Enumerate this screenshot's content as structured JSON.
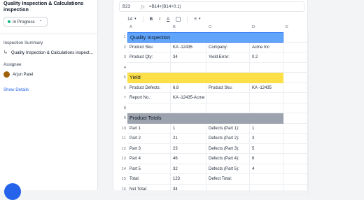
{
  "left_panel": {
    "title": "Quality Inspection & Calculations inspection",
    "status": "In Progress",
    "summary_heading": "Inspection Summary",
    "summary_item": "Quality Inspection & Calculations inspect...",
    "assignee_heading": "Assignee",
    "assignee_name": "Arjun Patel",
    "show_details": "Show Details"
  },
  "formula_bar": {
    "cell_ref": "B23",
    "fx": "fx",
    "formula": "=B14+(B14+0.1)"
  },
  "toolbar": {
    "font_size": "14",
    "bold": "B",
    "italic": "I",
    "color": "A"
  },
  "columns": [
    "A",
    "B",
    "C",
    "D",
    "E"
  ],
  "rows": [
    {
      "n": "1",
      "band": "blue",
      "title": "Quality Inspection"
    },
    {
      "n": "2",
      "cells": [
        "Product Sku:",
        "KA -12435",
        "Company:",
        "Acme Inc"
      ]
    },
    {
      "n": "3",
      "cells": [
        "Product Qty:",
        "34",
        "Yield Error:",
        "0.2"
      ]
    },
    {
      "n": "4",
      "cells": [
        "",
        "",
        "",
        ""
      ]
    },
    {
      "n": "5",
      "band": "yellow",
      "title": "Yield"
    },
    {
      "n": "6",
      "cells": [
        "Product Defects:",
        "6.8",
        "Product Sku:",
        "KA -12435"
      ]
    },
    {
      "n": "7",
      "cells": [
        "Report No.:",
        "KA -12435-Acme",
        "",
        ""
      ]
    },
    {
      "n": "8",
      "cells": [
        "",
        "",
        "",
        ""
      ]
    },
    {
      "n": "9",
      "band": "grey",
      "title": "Product Totals"
    },
    {
      "n": "10",
      "cells": [
        "Part 1",
        "1",
        "Defects (Part 1):",
        "1"
      ]
    },
    {
      "n": "11",
      "cells": [
        "Part 2",
        "21",
        "Defects (Part 2):",
        "3"
      ]
    },
    {
      "n": "12",
      "cells": [
        "Part 3",
        "23",
        "Defects (Part 3):",
        "5"
      ]
    },
    {
      "n": "13",
      "cells": [
        "Part 4",
        "46",
        "Defects (Part 4):",
        "6"
      ]
    },
    {
      "n": "14",
      "cells": [
        "Part 5",
        "32",
        "Defects (Part 5):",
        "4"
      ]
    },
    {
      "n": "15",
      "cells": [
        "Total:",
        "123",
        "Defect Total:",
        ""
      ]
    },
    {
      "n": "16",
      "cells": [
        "Net Total:",
        "34",
        "",
        ""
      ]
    }
  ],
  "colors": {
    "band_blue": "#60a5fa",
    "band_yellow": "#fde047",
    "band_grey": "#9ca3af",
    "status_dot": "#10b981",
    "link": "#2563eb"
  }
}
